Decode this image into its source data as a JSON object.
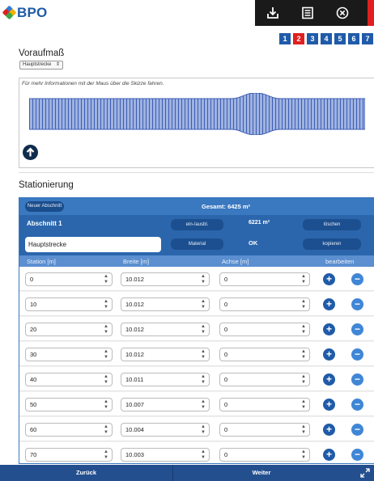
{
  "brand": {
    "logo_text": "BPO"
  },
  "steps": [
    "1",
    "2",
    "3",
    "4",
    "5",
    "6",
    "7"
  ],
  "active_step": "2",
  "voraufmass": {
    "title": "Voraufmaß",
    "select_value": "Hauptstrecke",
    "hint": "Für mehr Informationen mit der Maus über die Skizze fahren."
  },
  "stationierung": {
    "title": "Stationierung",
    "new_section_button": "Neuer Abschnitt",
    "total": "Gesamt: 6425 m²",
    "section": {
      "name_label": "Abschnitt 1",
      "ein_ausbl_button": "ein-/ausbl.",
      "area": "6221 m²",
      "delete_button": "löschen",
      "name_value": "Hauptstrecke",
      "material_button": "Material",
      "status": "OK",
      "copy_button": "kopieren"
    },
    "columns": {
      "station": "Station [m]",
      "breite": "Breite [m]",
      "achse": "Achse [m]",
      "bearbeiten": "bearbeiten"
    },
    "rows": [
      {
        "station": "0",
        "breite": "10.012",
        "achse": "0"
      },
      {
        "station": "10",
        "breite": "10.012",
        "achse": "0"
      },
      {
        "station": "20",
        "breite": "10.012",
        "achse": "0"
      },
      {
        "station": "30",
        "breite": "10.012",
        "achse": "0"
      },
      {
        "station": "40",
        "breite": "10.011",
        "achse": "0"
      },
      {
        "station": "50",
        "breite": "10.007",
        "achse": "0"
      },
      {
        "station": "60",
        "breite": "10.004",
        "achse": "0"
      },
      {
        "station": "70",
        "breite": "10.003",
        "achse": "0"
      }
    ]
  },
  "footer": {
    "back": "Zurück",
    "next": "Weiter"
  },
  "colors": {
    "brand_blue": "#1f5ba8",
    "accent_red": "#e02020",
    "header_dark": "#1a1a1a"
  }
}
